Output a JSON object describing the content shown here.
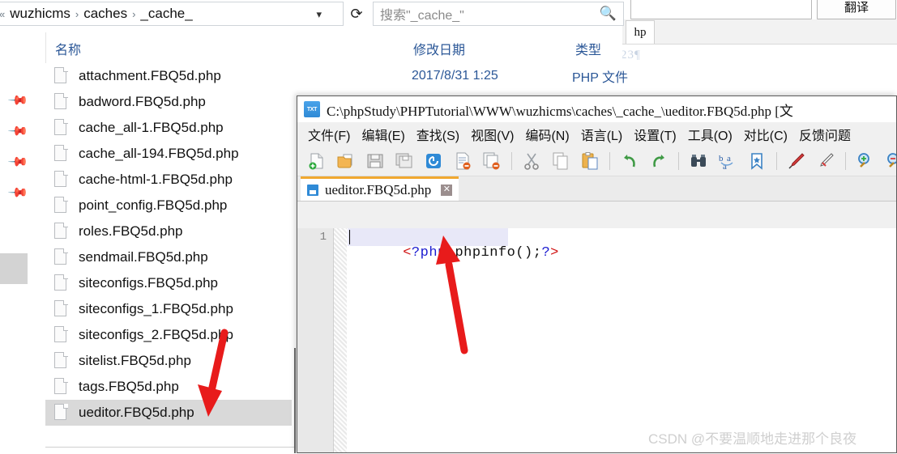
{
  "background_window": {
    "translate_button": "翻译",
    "tab_label": "hp",
    "faint_text": "23¶"
  },
  "explorer": {
    "breadcrumb": {
      "leading": "«",
      "items": [
        "wuzhicms",
        "caches",
        "_cache_"
      ],
      "separator": "›",
      "dropdown_icon": "chevron-down-icon",
      "refresh_icon": "↻",
      "refresh_glyph": "⟳"
    },
    "search": {
      "placeholder": "搜索\"_cache_\"",
      "icon": "search-icon"
    },
    "columns": [
      {
        "key": "name",
        "label": "名称"
      },
      {
        "key": "date",
        "label": "修改日期"
      },
      {
        "key": "type",
        "label": "类型"
      }
    ],
    "sort_indicator": "^",
    "nav_pane": {
      "pinned_items": [
        "pin-icon",
        "pin-icon",
        "pin-icon",
        "pin-icon"
      ]
    },
    "files": [
      {
        "name": "attachment.FBQ5d.php",
        "date": "2017/8/31 1:25",
        "type": "PHP 文件",
        "selected": false
      },
      {
        "name": "badword.FBQ5d.php",
        "date": "",
        "type": "",
        "selected": false
      },
      {
        "name": "cache_all-1.FBQ5d.php",
        "date": "",
        "type": "",
        "selected": false
      },
      {
        "name": "cache_all-194.FBQ5d.php",
        "date": "",
        "type": "",
        "selected": false
      },
      {
        "name": "cache-html-1.FBQ5d.php",
        "date": "",
        "type": "",
        "selected": false
      },
      {
        "name": "point_config.FBQ5d.php",
        "date": "",
        "type": "",
        "selected": false
      },
      {
        "name": "roles.FBQ5d.php",
        "date": "",
        "type": "",
        "selected": false
      },
      {
        "name": "sendmail.FBQ5d.php",
        "date": "",
        "type": "",
        "selected": false
      },
      {
        "name": "siteconfigs.FBQ5d.php",
        "date": "",
        "type": "",
        "selected": false
      },
      {
        "name": "siteconfigs_1.FBQ5d.php",
        "date": "",
        "type": "",
        "selected": false
      },
      {
        "name": "siteconfigs_2.FBQ5d.php",
        "date": "",
        "type": "",
        "selected": false
      },
      {
        "name": "sitelist.FBQ5d.php",
        "date": "",
        "type": "",
        "selected": false
      },
      {
        "name": "tags.FBQ5d.php",
        "date": "",
        "type": "",
        "selected": false
      },
      {
        "name": "ueditor.FBQ5d.php",
        "date": "",
        "type": "",
        "selected": true
      }
    ]
  },
  "notepad": {
    "title": "C:\\phpStudy\\PHPTutorial\\WWW\\wuzhicms\\caches\\_cache_\\ueditor.FBQ5d.php [文",
    "app_icon": "txt-file-icon",
    "menu": [
      "文件(F)",
      "编辑(E)",
      "查找(S)",
      "视图(V)",
      "编码(N)",
      "语言(L)",
      "设置(T)",
      "工具(O)",
      "对比(C)",
      "反馈问题"
    ],
    "toolbar": [
      "new-file-icon",
      "open-file-icon",
      "save-icon",
      "save-all-icon",
      "close-file-icon",
      "print-icon",
      "print-all-icon",
      "sep",
      "cut-icon",
      "copy-icon",
      "paste-icon",
      "sep",
      "undo-icon",
      "redo-icon",
      "sep",
      "find-icon",
      "replace-icon",
      "bookmark-icon",
      "sep",
      "red-pen-icon",
      "clear-pen-icon",
      "sep",
      "zoom-in-icon",
      "zoom-out-icon"
    ],
    "tab": {
      "label": "ueditor.FBQ5d.php",
      "icon": "saved-file-icon",
      "close_label": "✕"
    },
    "editor": {
      "line_number": "1",
      "code_tokens": [
        {
          "text": "<",
          "cls": "c-ang"
        },
        {
          "text": "?php",
          "cls": "c-php"
        },
        {
          "text": " ",
          "cls": "c-fn"
        },
        {
          "text": "phpinfo",
          "cls": "c-fn"
        },
        {
          "text": "();",
          "cls": "c-pn"
        },
        {
          "text": "?",
          "cls": "c-php"
        },
        {
          "text": ">",
          "cls": "c-ang"
        }
      ],
      "code_text": "<?php phpinfo();?>"
    }
  },
  "annotations": {
    "arrow_color": "#e81b1b",
    "arrows": [
      "arrow-to-selected-file",
      "arrow-to-code-line"
    ]
  },
  "watermark": "CSDN @不要温顺地走进那个良夜"
}
